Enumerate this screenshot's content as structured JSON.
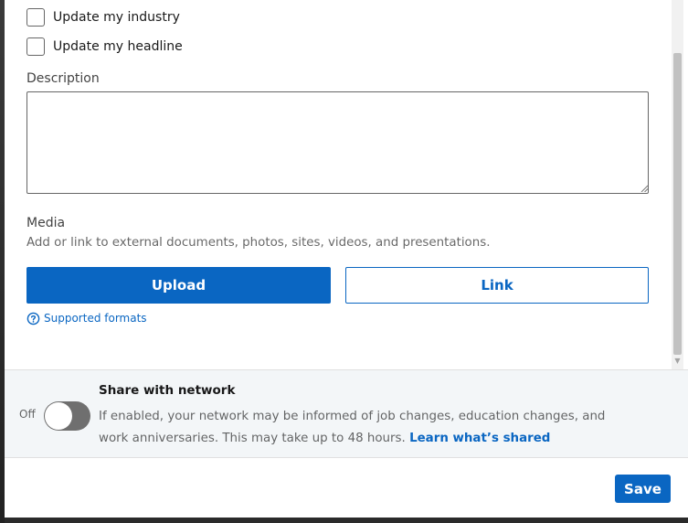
{
  "options": {
    "update_industry_label": "Update my industry",
    "update_headline_label": "Update my headline"
  },
  "description": {
    "label": "Description",
    "value": ""
  },
  "media": {
    "title": "Media",
    "help": "Add or link to external documents, photos, sites, videos, and presentations.",
    "upload_label": "Upload",
    "link_label": "Link",
    "supported_formats_label": "Supported formats"
  },
  "share": {
    "toggle_state_label": "Off",
    "title": "Share with network",
    "description": "If enabled, your network may be informed of job changes, education changes, and work anniversaries. This may take up to 48 hours.",
    "learn_more_label": "Learn what’s shared"
  },
  "footer": {
    "save_label": "Save"
  },
  "colors": {
    "primary": "#0a66c2",
    "share_bg": "#f3f6f8",
    "toggle_off": "#6f6f6f"
  },
  "icons": {
    "formats": "question-circle-icon",
    "scroll_down": "scroll-down-arrow-icon"
  }
}
